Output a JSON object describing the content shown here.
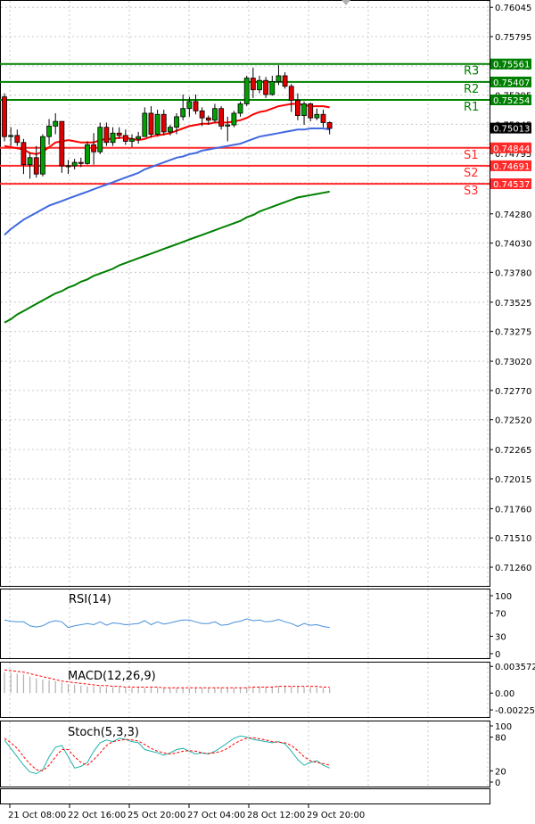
{
  "chart_data": {
    "type": "candlestick",
    "main": {
      "ylim": [
        0.711,
        0.761
      ],
      "y_ticks": [
        "0.76045",
        "0.75795",
        "0.75545",
        "0.75295",
        "0.75045",
        "0.74795",
        "0.74545",
        "0.74280",
        "0.74030",
        "0.73780",
        "0.73525",
        "0.73275",
        "0.73020",
        "0.72770",
        "0.72520",
        "0.72265",
        "0.72015",
        "0.71760",
        "0.71510",
        "0.71260"
      ],
      "last_price": "0.75013",
      "levels": [
        {
          "name": "R3",
          "value": "0.75561",
          "kind": "resistance"
        },
        {
          "name": "R2",
          "value": "0.75407",
          "kind": "resistance"
        },
        {
          "name": "R1",
          "value": "0.75254",
          "kind": "resistance"
        },
        {
          "name": "S1",
          "value": "0.74844",
          "kind": "support"
        },
        {
          "name": "S2",
          "value": "0.74691",
          "kind": "support"
        },
        {
          "name": "S3",
          "value": "0.74537",
          "kind": "support"
        }
      ],
      "candles": [
        [
          0.7528,
          0.7531,
          0.749,
          0.7494
        ],
        [
          0.7494,
          0.7502,
          0.7486,
          0.7495
        ],
        [
          0.7495,
          0.75,
          0.7486,
          0.7489
        ],
        [
          0.7489,
          0.7492,
          0.7462,
          0.747
        ],
        [
          0.747,
          0.748,
          0.7458,
          0.7476
        ],
        [
          0.7476,
          0.7486,
          0.7459,
          0.7462
        ],
        [
          0.7462,
          0.7496,
          0.746,
          0.7494
        ],
        [
          0.7494,
          0.7509,
          0.7487,
          0.7503
        ],
        [
          0.7503,
          0.7514,
          0.7496,
          0.7507
        ],
        [
          0.7507,
          0.7507,
          0.7463,
          0.7469
        ],
        [
          0.7469,
          0.7474,
          0.7462,
          0.7469
        ],
        [
          0.7469,
          0.7475,
          0.7466,
          0.7472
        ],
        [
          0.7472,
          0.7476,
          0.7468,
          0.7471
        ],
        [
          0.7471,
          0.749,
          0.747,
          0.7487
        ],
        [
          0.7487,
          0.7497,
          0.747,
          0.7481
        ],
        [
          0.7481,
          0.7506,
          0.7479,
          0.7502
        ],
        [
          0.7502,
          0.7506,
          0.7486,
          0.7489
        ],
        [
          0.7489,
          0.7502,
          0.7486,
          0.7497
        ],
        [
          0.7497,
          0.7502,
          0.7492,
          0.7495
        ],
        [
          0.7495,
          0.75,
          0.7487,
          0.749
        ],
        [
          0.749,
          0.7496,
          0.7485,
          0.7492
        ],
        [
          0.7492,
          0.7498,
          0.7488,
          0.7494
        ],
        [
          0.7494,
          0.7519,
          0.7494,
          0.7514
        ],
        [
          0.7514,
          0.752,
          0.7493,
          0.7496
        ],
        [
          0.7496,
          0.7517,
          0.7494,
          0.7513
        ],
        [
          0.7513,
          0.7517,
          0.7495,
          0.7498
        ],
        [
          0.7498,
          0.7504,
          0.7495,
          0.7502
        ],
        [
          0.7502,
          0.7514,
          0.7496,
          0.7511
        ],
        [
          0.7511,
          0.753,
          0.7508,
          0.7518
        ],
        [
          0.7518,
          0.7528,
          0.7511,
          0.7524
        ],
        [
          0.7524,
          0.753,
          0.7513,
          0.7516
        ],
        [
          0.7516,
          0.7519,
          0.7503,
          0.751
        ],
        [
          0.751,
          0.7512,
          0.7504,
          0.7508
        ],
        [
          0.7508,
          0.7522,
          0.7506,
          0.7518
        ],
        [
          0.7518,
          0.752,
          0.75,
          0.7503
        ],
        [
          0.7503,
          0.7511,
          0.749,
          0.7504
        ],
        [
          0.7504,
          0.7516,
          0.7502,
          0.7514
        ],
        [
          0.7514,
          0.7524,
          0.7511,
          0.7522
        ],
        [
          0.7522,
          0.7546,
          0.752,
          0.7544
        ],
        [
          0.7544,
          0.7553,
          0.7527,
          0.7534
        ],
        [
          0.7534,
          0.7546,
          0.7531,
          0.7542
        ],
        [
          0.7542,
          0.7545,
          0.7527,
          0.753
        ],
        [
          0.753,
          0.7546,
          0.7529,
          0.7541
        ],
        [
          0.7541,
          0.7555,
          0.7538,
          0.7546
        ],
        [
          0.7546,
          0.7549,
          0.7535,
          0.7537
        ],
        [
          0.7537,
          0.7539,
          0.7515,
          0.7525
        ],
        [
          0.7525,
          0.7531,
          0.7508,
          0.7512
        ],
        [
          0.7512,
          0.7524,
          0.7504,
          0.7522
        ],
        [
          0.7522,
          0.7523,
          0.7507,
          0.751
        ],
        [
          0.751,
          0.7518,
          0.7508,
          0.7513
        ],
        [
          0.7513,
          0.7517,
          0.7502,
          0.7506
        ],
        [
          0.7506,
          0.7507,
          0.7496,
          0.7501
        ]
      ],
      "ma_short": {
        "color": "#ff0000",
        "values": [
          0.7486,
          0.7485,
          0.7484,
          0.7483,
          0.748,
          0.7479,
          0.7481,
          0.7485,
          0.7489,
          0.749,
          0.7491,
          0.749,
          0.7489,
          0.7489,
          0.7489,
          0.7491,
          0.7492,
          0.7492,
          0.7493,
          0.7493,
          0.7492,
          0.7491,
          0.7492,
          0.7494,
          0.7495,
          0.7496,
          0.7497,
          0.7499,
          0.7501,
          0.7503,
          0.7504,
          0.7505,
          0.7505,
          0.7506,
          0.7506,
          0.7506,
          0.7507,
          0.7508,
          0.751,
          0.7513,
          0.7515,
          0.7516,
          0.7518,
          0.752,
          0.7521,
          0.7522,
          0.7522,
          0.7521,
          0.752,
          0.752,
          0.752,
          0.7519
        ]
      },
      "ma_mid": {
        "color": "#4169e1",
        "values": [
          0.741,
          0.7415,
          0.7419,
          0.7423,
          0.7426,
          0.7429,
          0.7432,
          0.7435,
          0.7437,
          0.7439,
          0.7441,
          0.7443,
          0.7445,
          0.7447,
          0.7449,
          0.7451,
          0.7453,
          0.7455,
          0.7457,
          0.7459,
          0.7461,
          0.7463,
          0.7466,
          0.7468,
          0.747,
          0.7472,
          0.7474,
          0.7476,
          0.7477,
          0.7479,
          0.748,
          0.7482,
          0.7483,
          0.7484,
          0.7485,
          0.7486,
          0.7487,
          0.7488,
          0.749,
          0.7492,
          0.7494,
          0.7495,
          0.7496,
          0.7497,
          0.7498,
          0.7499,
          0.75,
          0.75,
          0.7501,
          0.7501,
          0.7501,
          0.75
        ]
      },
      "ma_long": {
        "color": "#008000",
        "values": [
          0.7335,
          0.7338,
          0.7342,
          0.7345,
          0.7348,
          0.7351,
          0.7354,
          0.7357,
          0.736,
          0.7362,
          0.7365,
          0.7367,
          0.737,
          0.7372,
          0.7375,
          0.7377,
          0.7379,
          0.7381,
          0.7384,
          0.7386,
          0.7388,
          0.739,
          0.7392,
          0.7394,
          0.7396,
          0.7398,
          0.74,
          0.7402,
          0.7404,
          0.7406,
          0.7408,
          0.741,
          0.7412,
          0.7414,
          0.7416,
          0.7418,
          0.742,
          0.7422,
          0.7425,
          0.7427,
          0.743,
          0.7432,
          0.7434,
          0.7436,
          0.7438,
          0.744,
          0.7442,
          0.7443,
          0.7444,
          0.7445,
          0.7446,
          0.7447
        ]
      }
    },
    "rsi": {
      "label": "RSI(14)",
      "ylim": [
        0,
        100
      ],
      "ticks": [
        "100",
        "70",
        "30",
        "0"
      ],
      "color": "#4a90d9",
      "values": [
        58,
        56,
        55,
        55,
        48,
        46,
        48,
        54,
        57,
        55,
        45,
        48,
        50,
        52,
        50,
        55,
        49,
        53,
        52,
        50,
        51,
        52,
        57,
        50,
        55,
        51,
        53,
        56,
        58,
        58,
        55,
        52,
        52,
        55,
        49,
        50,
        54,
        56,
        60,
        57,
        58,
        55,
        56,
        59,
        55,
        52,
        47,
        52,
        49,
        50,
        47,
        45
      ]
    },
    "macd": {
      "label": "MACD(12,26,9)",
      "ylim": [
        -0.0026,
        0.0036
      ],
      "ticks": [
        "0.003572",
        "0.00",
        "-0.002251"
      ],
      "histogram_color": "#b0b0b0",
      "signal_color": "#ff0000",
      "histogram": [
        0.0028,
        0.0027,
        0.0026,
        0.0025,
        0.0022,
        0.002,
        0.0018,
        0.0017,
        0.0016,
        0.0014,
        0.0012,
        0.0011,
        0.001,
        0.0009,
        0.0009,
        0.0009,
        0.0008,
        0.0008,
        0.0008,
        0.0007,
        0.0007,
        0.0007,
        0.0007,
        0.0007,
        0.0007,
        0.0007,
        0.0007,
        0.0007,
        0.0007,
        0.0007,
        0.0007,
        0.0007,
        0.0007,
        0.0007,
        0.0007,
        0.0007,
        0.0007,
        0.0007,
        0.0008,
        0.0008,
        0.0009,
        0.0009,
        0.0009,
        0.001,
        0.001,
        0.0009,
        0.0009,
        0.0008,
        0.0008,
        0.0008,
        0.0007,
        0.0007
      ],
      "signal": [
        0.0031,
        0.003,
        0.0029,
        0.0028,
        0.0026,
        0.0024,
        0.0022,
        0.002,
        0.0018,
        0.0016,
        0.0015,
        0.0014,
        0.0013,
        0.0012,
        0.0011,
        0.001,
        0.001,
        0.0009,
        0.0009,
        0.0008,
        0.0008,
        0.0008,
        0.0008,
        0.0008,
        0.0008,
        0.0007,
        0.0007,
        0.0007,
        0.0007,
        0.0007,
        0.0007,
        0.0007,
        0.0007,
        0.0007,
        0.0007,
        0.0007,
        0.0007,
        0.0007,
        0.0007,
        0.0008,
        0.0008,
        0.0008,
        0.0008,
        0.0009,
        0.0009,
        0.0009,
        0.0009,
        0.0009,
        0.0009,
        0.0009,
        0.0008,
        0.0008
      ]
    },
    "stoch": {
      "label": "Stoch(5,3,3)",
      "ylim": [
        0,
        100
      ],
      "ticks": [
        "100",
        "80",
        "20",
        "0"
      ],
      "k_color": "#20b2aa",
      "d_color": "#ff0000",
      "k": [
        75,
        60,
        45,
        30,
        18,
        15,
        22,
        45,
        62,
        65,
        45,
        25,
        28,
        35,
        55,
        70,
        75,
        72,
        78,
        76,
        72,
        70,
        58,
        55,
        52,
        48,
        52,
        58,
        60,
        55,
        50,
        52,
        50,
        55,
        62,
        70,
        78,
        82,
        80,
        76,
        74,
        72,
        70,
        72,
        68,
        55,
        40,
        30,
        35,
        38,
        30,
        25
      ],
      "d": [
        78,
        70,
        60,
        45,
        32,
        22,
        20,
        30,
        45,
        58,
        58,
        45,
        35,
        30,
        40,
        52,
        65,
        72,
        74,
        76,
        75,
        73,
        67,
        60,
        55,
        52,
        50,
        52,
        55,
        56,
        55,
        52,
        51,
        52,
        55,
        60,
        68,
        74,
        78,
        79,
        77,
        75,
        72,
        71,
        70,
        65,
        56,
        45,
        38,
        35,
        33,
        30
      ]
    },
    "x_labels": [
      "21 Oct 08:00",
      "22 Oct 16:00",
      "25 Oct 20:00",
      "27 Oct 04:00",
      "28 Oct 12:00",
      "29 Oct 20:00"
    ]
  }
}
